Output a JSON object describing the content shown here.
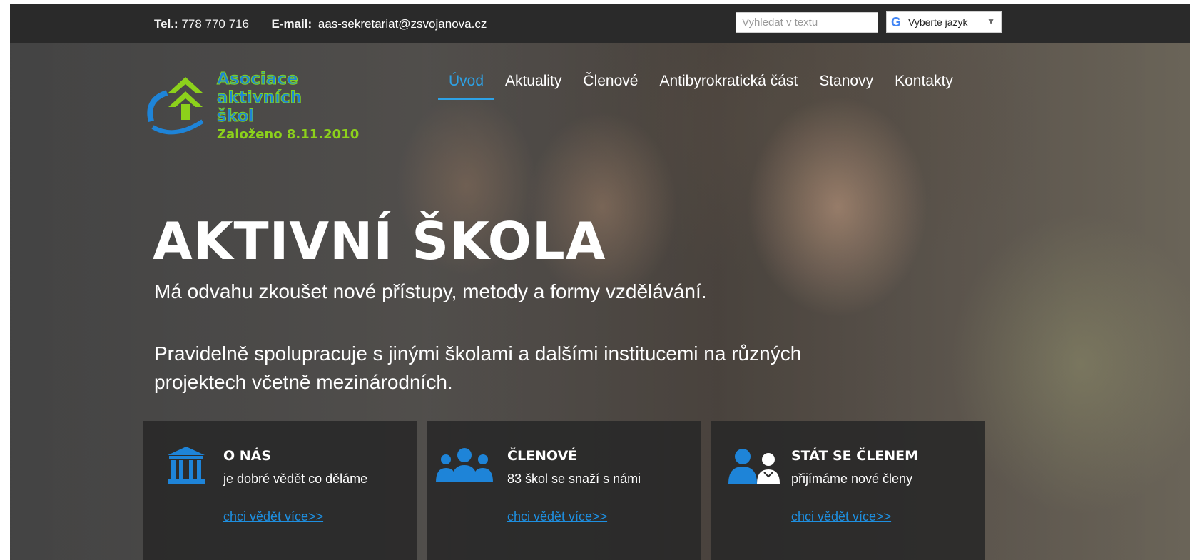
{
  "topbar": {
    "tel_label": "Tel.:",
    "tel_value": "778 770 716",
    "email_label": "E-mail:",
    "email_value": "aas-sekretariat@zsvojanova.cz",
    "search_placeholder": "Vyhledat v textu",
    "language_label": "Vyberte jazyk",
    "language_caret": "▼",
    "google_glyph": "G"
  },
  "logo": {
    "line1": "Asociace",
    "line2": "aktivních",
    "line3": "škol",
    "founded": "Založeno 8.11.2010"
  },
  "nav": {
    "items": [
      {
        "label": "Úvod",
        "active": true
      },
      {
        "label": "Aktuality",
        "active": false
      },
      {
        "label": "Členové",
        "active": false
      },
      {
        "label": "Antibyrokratická část",
        "active": false
      },
      {
        "label": "Stanovy",
        "active": false
      },
      {
        "label": "Kontakty",
        "active": false
      }
    ]
  },
  "hero": {
    "headline": "AKTIVNÍ ŠKOLA",
    "subline1": "Má odvahu zkoušet nové přístupy, metody a formy vzdělávání.",
    "subline2": "Pravidelně spolupracuje s jinými školami a dalšími institucemi na různých projektech včetně mezinárodních."
  },
  "cards": [
    {
      "icon": "bank-icon",
      "title": "O NÁS",
      "desc": "je dobré vědět co děláme",
      "link": "chci vědět více>>"
    },
    {
      "icon": "people-group-icon",
      "title": "ČLENOVÉ",
      "desc": "83 škol se snaží s námi",
      "link": "chci vědět více>>"
    },
    {
      "icon": "user-add-icon",
      "title": "STÁT SE ČLENEM",
      "desc": "přijímáme nové členy",
      "link": "chci vědět více>>"
    }
  ],
  "colors": {
    "accent": "#2ea2e6",
    "icon_blue": "#1e84d8",
    "logo_green": "#8cd11b",
    "topbar_bg": "#2a2a2a",
    "card_bg": "#282828"
  }
}
